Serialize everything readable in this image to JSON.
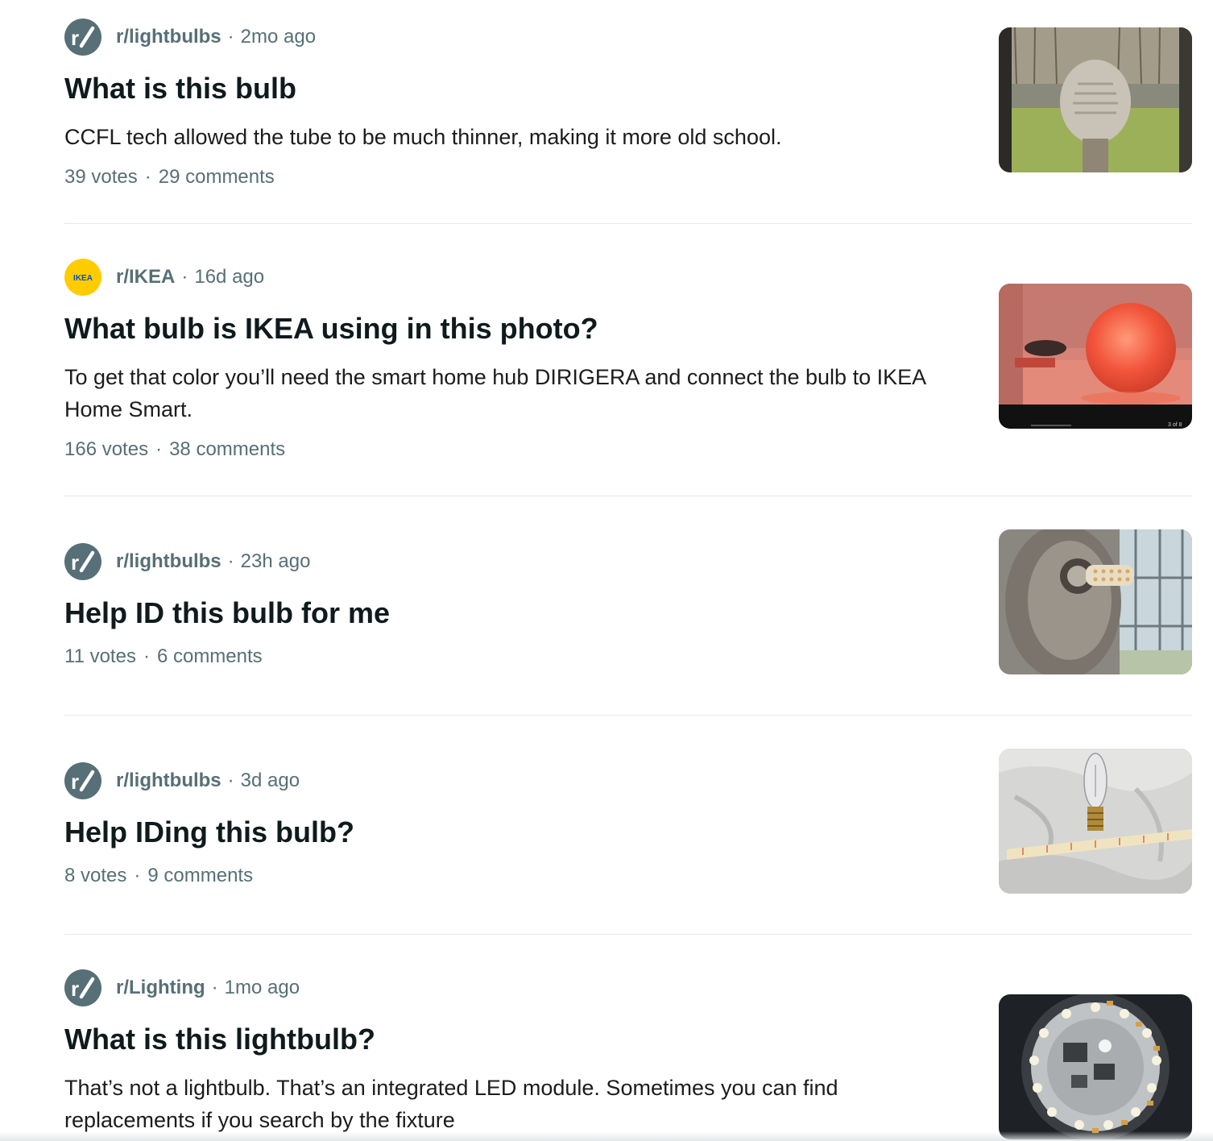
{
  "posts": [
    {
      "subreddit": "r/lightbulbs",
      "time": "2mo ago",
      "title": "What is this bulb",
      "snippet": "CCFL tech allowed the tube to be much thinner, making it more old school.",
      "votes": "39 votes",
      "comments": "29 comments",
      "avatar_icon": "reddit-r-slash-icon",
      "thumbnail": "frosted-bulb-window-photo"
    },
    {
      "subreddit": "r/IKEA",
      "time": "16d ago",
      "title": "What bulb is IKEA using in this photo?",
      "snippet": "To get that color you’ll need the smart home hub DIRIGERA and connect the bulb to IKEA Home Smart.",
      "votes": "166 votes",
      "comments": "38 comments",
      "avatar_icon": "ikea-logo-icon",
      "avatar_text": "IKEA",
      "thumbnail": "red-globe-lamp-photo",
      "thumbnail_caption": "3 of 8"
    },
    {
      "subreddit": "r/lightbulbs",
      "time": "23h ago",
      "title": "Help ID this bulb for me",
      "votes": "11 votes",
      "comments": "6 comments",
      "avatar_icon": "reddit-r-slash-icon",
      "thumbnail": "wall-sconce-bulb-photo"
    },
    {
      "subreddit": "r/lightbulbs",
      "time": "3d ago",
      "title": "Help IDing this bulb?",
      "votes": "8 votes",
      "comments": "9 comments",
      "avatar_icon": "reddit-r-slash-icon",
      "thumbnail": "candelabra-bulb-tape-photo"
    },
    {
      "subreddit": "r/Lighting",
      "time": "1mo ago",
      "title": "What is this lightbulb?",
      "snippet": "That’s not a lightbulb. That’s an integrated LED module. Sometimes you can find replacements if you search by the fixture",
      "avatar_icon": "reddit-r-slash-icon",
      "thumbnail": "led-module-photo"
    }
  ],
  "separator": "·",
  "colors": {
    "meta_text": "#576f76",
    "title_text": "#0f1a1c",
    "avatar_default": "#576f76",
    "avatar_ikea": "#ffcc00",
    "divider": "#e5e7e9"
  }
}
